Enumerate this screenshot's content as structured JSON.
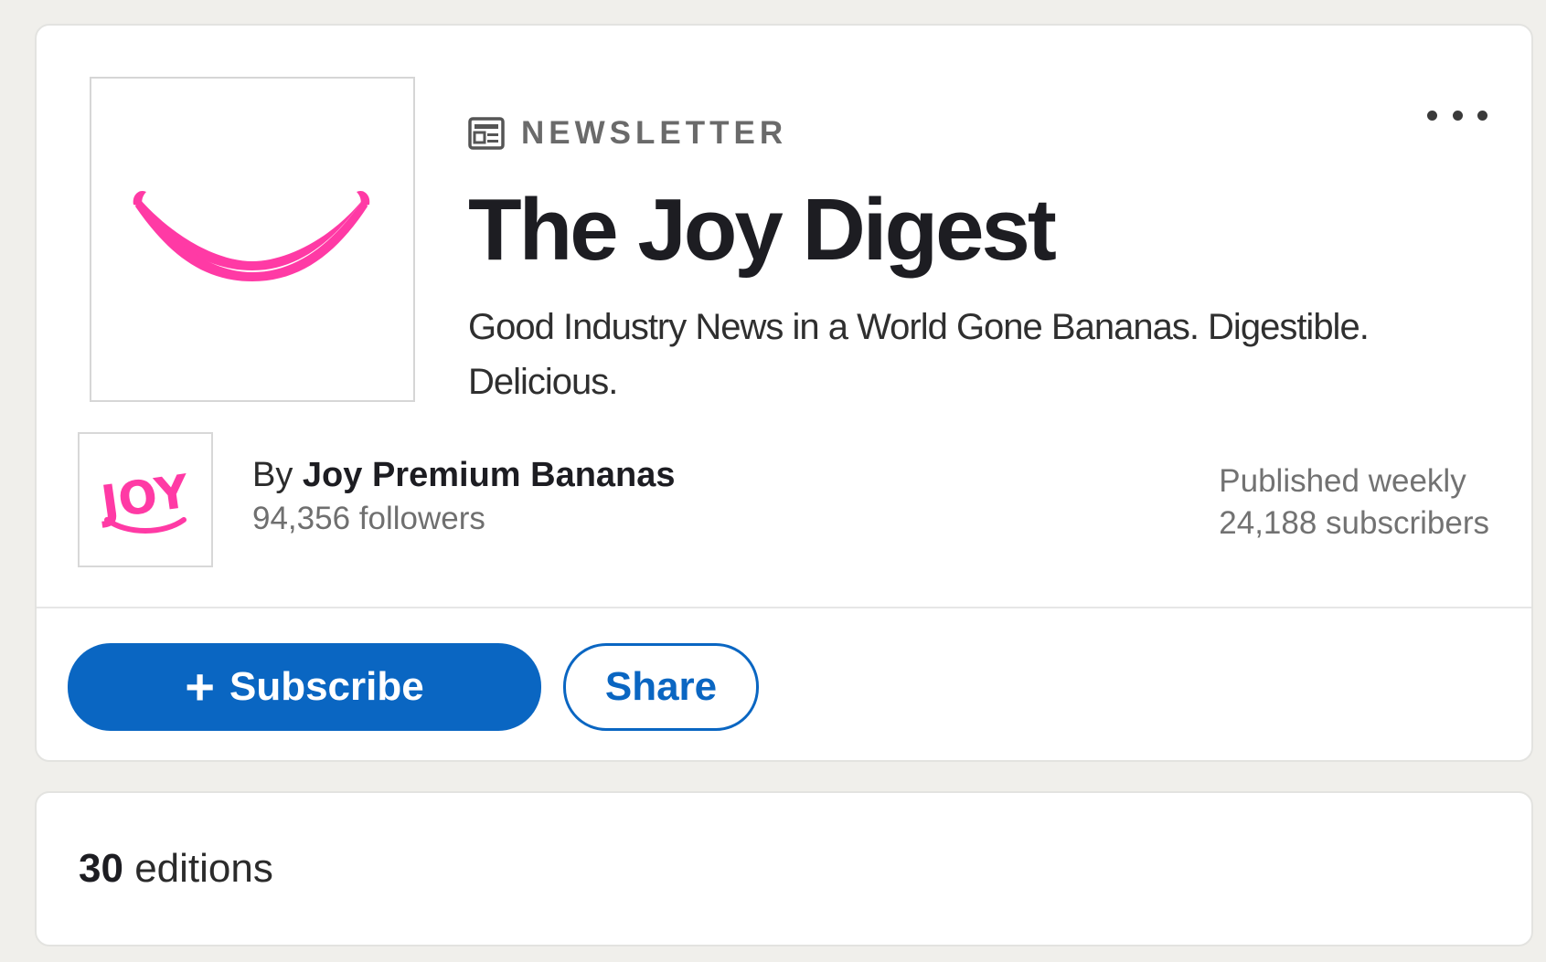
{
  "newsletter": {
    "kicker": "NEWSLETTER",
    "kicker_icon": "newsletter-icon",
    "title": "The Joy Digest",
    "description": "Good Industry News in a World Gone Bananas. Digestible. Delicious.",
    "cover_icon": "smile-icon",
    "cover_color": "#ff3aa5"
  },
  "author": {
    "by_prefix": "By",
    "name": "Joy Premium Bananas",
    "followers": "94,356 followers",
    "logo_text": "JOY",
    "logo_color": "#ff3aa5"
  },
  "publication": {
    "frequency": "Published weekly",
    "subscribers": "24,188 subscribers"
  },
  "actions": {
    "subscribe_icon": "+",
    "subscribe_label": "Subscribe",
    "share_label": "Share",
    "more_icon": "more-horizontal-icon",
    "accent_color": "#0a66c2"
  },
  "editions": {
    "count": "30",
    "label": "editions"
  }
}
